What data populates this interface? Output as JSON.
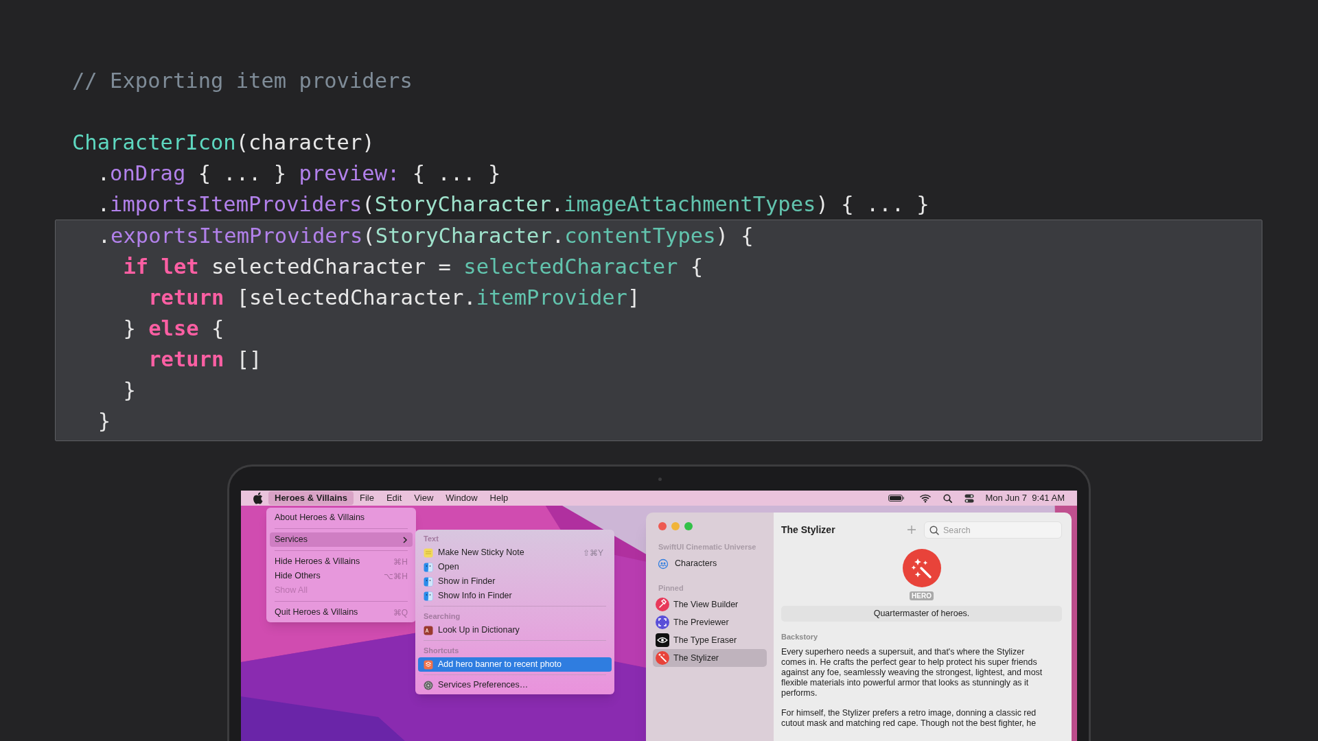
{
  "code": [
    {
      "highlighted": false,
      "lines": [
        [
          {
            "text": "// Exporting item providers",
            "kind": "comment"
          }
        ]
      ]
    },
    {
      "highlighted": false,
      "lines": [
        [
          {
            "text": "CharacterIcon",
            "kind": "call"
          },
          {
            "text": "(character)",
            "kind": "plain"
          }
        ],
        [
          {
            "text": "  .",
            "kind": "plain"
          },
          {
            "text": "onDrag",
            "kind": "method"
          },
          {
            "text": " { ... } ",
            "kind": "plain"
          },
          {
            "text": "preview:",
            "kind": "method"
          },
          {
            "text": " { ... }",
            "kind": "plain"
          }
        ],
        [
          {
            "text": "  .",
            "kind": "plain"
          },
          {
            "text": "importsItemProviders",
            "kind": "method"
          },
          {
            "text": "(",
            "kind": "plain"
          },
          {
            "text": "StoryCharacter",
            "kind": "type"
          },
          {
            "text": ".",
            "kind": "plain"
          },
          {
            "text": "imageAttachmentTypes",
            "kind": "property"
          },
          {
            "text": ") { ... }",
            "kind": "plain"
          }
        ]
      ]
    },
    {
      "highlighted": true,
      "lines": [
        [
          {
            "text": "  .",
            "kind": "plain"
          },
          {
            "text": "exportsItemProviders",
            "kind": "method"
          },
          {
            "text": "(",
            "kind": "plain"
          },
          {
            "text": "StoryCharacter",
            "kind": "type"
          },
          {
            "text": ".",
            "kind": "plain"
          },
          {
            "text": "contentTypes",
            "kind": "property"
          },
          {
            "text": ") {",
            "kind": "plain"
          }
        ],
        [
          {
            "text": "    if let",
            "kind": "keyword"
          },
          {
            "text": " selectedCharacter = ",
            "kind": "plain"
          },
          {
            "text": "selectedCharacter",
            "kind": "property"
          },
          {
            "text": " {",
            "kind": "plain"
          }
        ],
        [
          {
            "text": "      return",
            "kind": "keyword"
          },
          {
            "text": " [selectedCharacter.",
            "kind": "plain"
          },
          {
            "text": "itemProvider",
            "kind": "property"
          },
          {
            "text": "]",
            "kind": "plain"
          }
        ],
        [
          {
            "text": "    } ",
            "kind": "plain"
          },
          {
            "text": "else",
            "kind": "keyword"
          },
          {
            "text": " {",
            "kind": "plain"
          }
        ],
        [
          {
            "text": "      return",
            "kind": "keyword"
          },
          {
            "text": " []",
            "kind": "plain"
          }
        ],
        [
          {
            "text": "    }",
            "kind": "plain"
          }
        ],
        [
          {
            "text": "  }",
            "kind": "plain"
          }
        ]
      ]
    }
  ],
  "menu_bar": {
    "items": [
      {
        "label": "Heroes & Villains",
        "kind": "app",
        "selected": true
      },
      {
        "label": "File",
        "kind": "menu",
        "selected": false
      },
      {
        "label": "Edit",
        "kind": "menu",
        "selected": false
      },
      {
        "label": "View",
        "kind": "menu",
        "selected": false
      },
      {
        "label": "Window",
        "kind": "menu",
        "selected": false
      },
      {
        "label": "Help",
        "kind": "menu",
        "selected": false
      }
    ],
    "clock": "Mon Jun 7  9:41 AM"
  },
  "app_menu": {
    "items": [
      {
        "kind": "item",
        "label": "About Heroes & Villains",
        "disabled": false,
        "selected": false
      },
      {
        "kind": "separator"
      },
      {
        "kind": "submenu",
        "label": "Services",
        "disabled": false,
        "selected": true
      },
      {
        "kind": "separator"
      },
      {
        "kind": "item",
        "label": "Hide Heroes & Villains",
        "shortcut": "⌘H",
        "disabled": false,
        "selected": false
      },
      {
        "kind": "item",
        "label": "Hide Others",
        "shortcut": "⌥⌘H",
        "disabled": false,
        "selected": false
      },
      {
        "kind": "item",
        "label": "Show All",
        "disabled": true,
        "selected": false
      },
      {
        "kind": "separator"
      },
      {
        "kind": "item",
        "label": "Quit Heroes & Villains",
        "shortcut": "⌘Q",
        "disabled": false,
        "selected": false
      }
    ]
  },
  "services_menu": {
    "sections": [
      {
        "header": "Text",
        "items": [
          {
            "kind": "note",
            "label": "Make New Sticky Note",
            "shortcut": "⇧⌘Y",
            "selected": false
          },
          {
            "kind": "finder",
            "label": "Open",
            "selected": false
          },
          {
            "kind": "finder",
            "label": "Show in Finder",
            "selected": false
          },
          {
            "kind": "finder",
            "label": "Show Info in Finder",
            "selected": false
          }
        ]
      },
      {
        "header": "Searching",
        "items": [
          {
            "kind": "dictionary",
            "label": "Look Up in Dictionary",
            "selected": false
          }
        ]
      },
      {
        "header": "Shortcuts",
        "items": [
          {
            "kind": "shortcut",
            "label": "Add hero banner to recent photo",
            "selected": true
          }
        ]
      },
      {
        "items": [
          {
            "kind": "gear",
            "label": "Services Preferences…",
            "selected": false
          }
        ]
      }
    ]
  },
  "window": {
    "sidebar": {
      "sections": [
        {
          "header": "SwiftUI Cinematic Universe",
          "items": [
            {
              "kind": "group",
              "label": "Characters",
              "selected": false
            }
          ]
        },
        {
          "header": "Pinned",
          "items": [
            {
              "kind": "hammer",
              "label": "The View Builder",
              "color": "#e8385a",
              "selected": false
            },
            {
              "kind": "frame",
              "label": "The Previewer",
              "color": "#5a4fd8",
              "selected": false
            },
            {
              "kind": "eye",
              "label": "The Type Eraser",
              "color": "#111111",
              "selected": false
            },
            {
              "kind": "wand",
              "label": "The Stylizer",
              "color": "#e8433a",
              "selected": true
            }
          ]
        }
      ]
    },
    "detail": {
      "title": "The Stylizer",
      "search": {
        "placeholder": "Search"
      },
      "badge": "HERO",
      "tagline": "Quartermaster of heroes.",
      "section": "Backstory",
      "paragraphs": [
        "Every superhero needs a supersuit, and that's where the Stylizer comes in. He crafts the perfect gear to help protect his super friends against any foe, seamlessly weaving the strongest, lightest, and most flexible materials into powerful armor that looks as stunningly as it performs.",
        "For himself, the Stylizer prefers a retro image, donning a classic red cutout mask and matching red cape. Though not the best fighter, he"
      ]
    }
  }
}
